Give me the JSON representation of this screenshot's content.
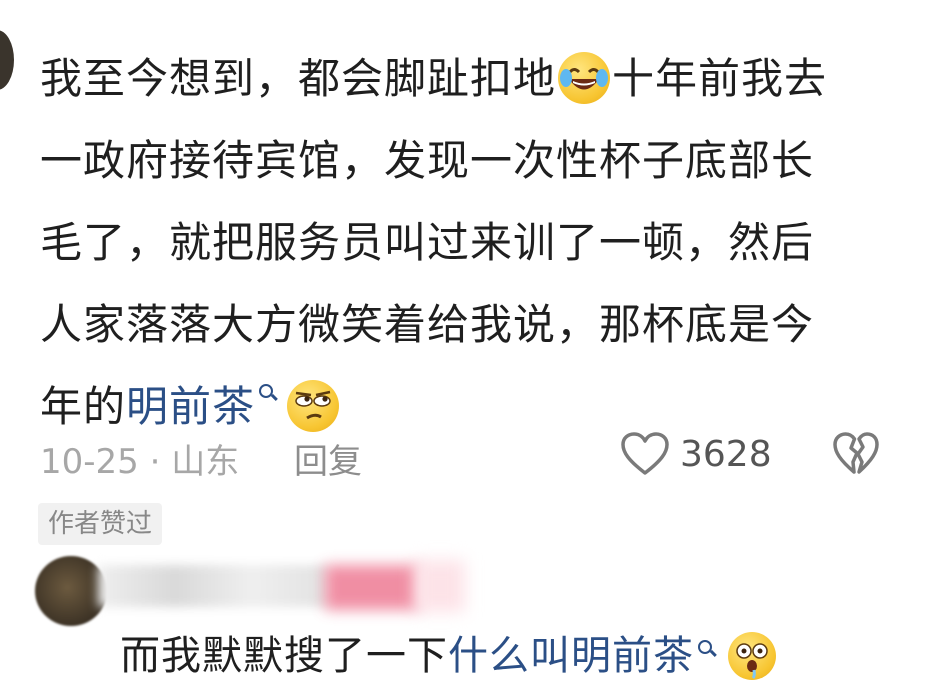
{
  "comment": {
    "line1_a": "我至今想到，都会脚趾扣地",
    "line1_b": "十年前我去",
    "line2": "一政府接待宾馆，发现一次性杯子底部长",
    "line3": "毛了，就把服务员叫过来训了一顿，然后",
    "line4": "人家落落大方微笑着给我说，那杯底是今",
    "line5_prefix": "年的",
    "line5_link": "明前茶",
    "emoji_1": "laugh-cry-emoji",
    "emoji_2": "eye-roll-emoji"
  },
  "meta": {
    "date_location": "10-25 · 山东",
    "reply_label": "回复",
    "like_count": "3628"
  },
  "badge": "作者赞过",
  "reply": {
    "prefix": "而我默默搜了一下",
    "link": "什么叫明前茶",
    "emoji": "shocked-drool-emoji"
  },
  "colors": {
    "link": "#2b4f86",
    "meta": "#a7a7a7",
    "badge_bg": "#f1f1f1"
  }
}
